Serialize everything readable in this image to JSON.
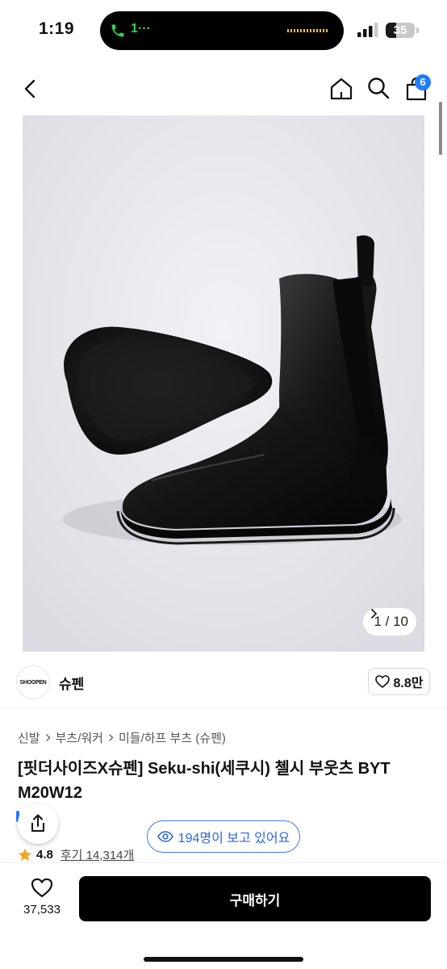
{
  "status_bar": {
    "time": "1:19",
    "call_label": "1···",
    "battery": "35",
    "battery_level": 0.35
  },
  "nav": {
    "cart_count": "6",
    "icons": [
      "back-icon",
      "home-icon",
      "search-icon",
      "bag-icon"
    ]
  },
  "gallery": {
    "counter": "1 / 10"
  },
  "brand": {
    "logo_text": "SHOOPEN",
    "name": "슈펜",
    "likes": "8.8만"
  },
  "breadcrumb": [
    "신발",
    "부츠/워커",
    "미들/하프 부츠 (슈펜)"
  ],
  "product": {
    "title_line1": "[핏더사이즈X슈펜] Seku-shi(세쿠시) 첼시 부웃츠 BYT",
    "title_line2": "M20W12",
    "viewers": "194명이 보고 있어요",
    "rating": "4.8",
    "reviews": "후기 14,314개"
  },
  "bottom_bar": {
    "wish_count": "37,533",
    "buy_label": "구매하기"
  },
  "colors": {
    "accent_blue": "#1f7dff",
    "viewer_blue": "#2a67d8",
    "call_green": "#30d158",
    "star": "#f5a623",
    "buy_bg": "#000000"
  }
}
